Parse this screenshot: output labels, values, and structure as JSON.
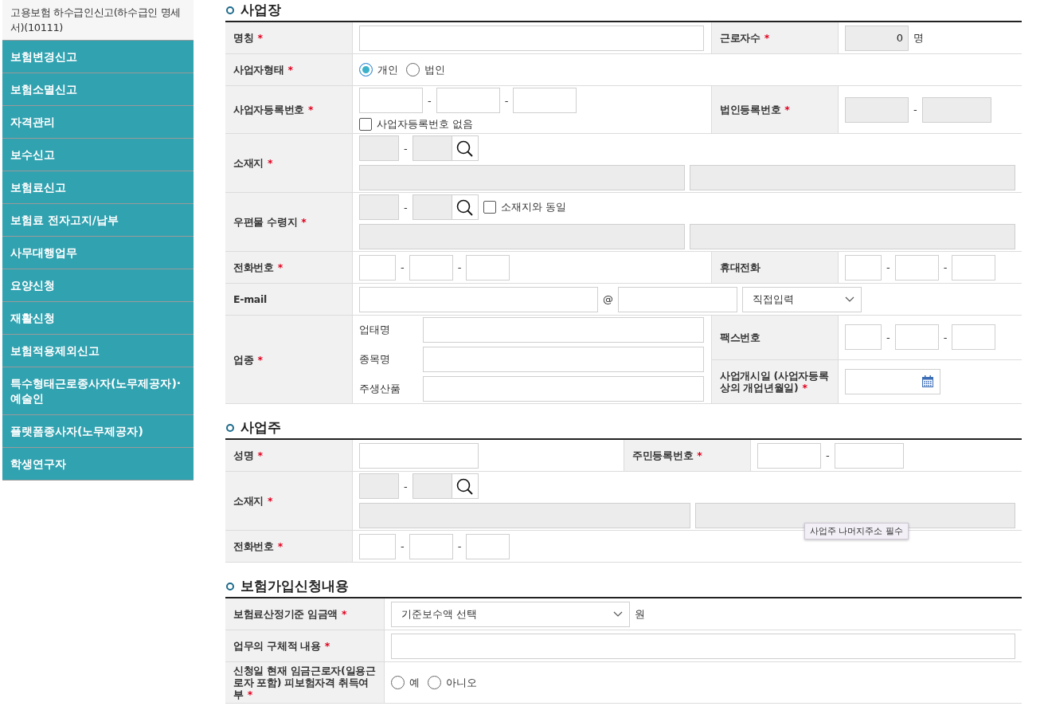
{
  "sidebar": {
    "current": "고용보험 하수급인신고(하수급인 명세서)(10111)",
    "items": [
      "보험변경신고",
      "보험소멸신고",
      "자격관리",
      "보수신고",
      "보험료신고",
      "보험료 전자고지/납부",
      "사무대행업무",
      "요양신청",
      "재활신청",
      "보험적용제외신고",
      "특수형태근로종사자(노무제공자)·예술인",
      "플랫폼종사자(노무제공자)",
      "학생연구자"
    ]
  },
  "sections": [
    {
      "title": "사업장",
      "rows": [
        {
          "fields": [
            {
              "label": "명칭",
              "required_mark": "*",
              "lines": [
                [
                  {
                    "kind": "input",
                    "disabled": false
                  }
                ]
              ]
            },
            {
              "label": "근로자수",
              "required_mark": "*",
              "lines": [
                [
                  {
                    "kind": "input",
                    "disabled": true,
                    "value": "0"
                  },
                  {
                    "kind": "unit",
                    "text": "명"
                  }
                ]
              ]
            }
          ]
        },
        {
          "fields": [
            {
              "label": "사업자형태",
              "required_mark": "*",
              "lines": [
                [
                  {
                    "kind": "radio",
                    "label": "개인",
                    "selected": true
                  },
                  {
                    "kind": "radio",
                    "label": "법인",
                    "selected": false
                  }
                ]
              ]
            }
          ]
        },
        {
          "fields": [
            {
              "label": "사업자등록번호",
              "required_mark": "*",
              "lines": [
                [
                  {
                    "kind": "input",
                    "disabled": false
                  },
                  {
                    "kind": "sep",
                    "text": "-"
                  },
                  {
                    "kind": "input",
                    "disabled": false
                  },
                  {
                    "kind": "sep",
                    "text": "-"
                  },
                  {
                    "kind": "input",
                    "disabled": false
                  }
                ],
                [
                  {
                    "kind": "checkbox",
                    "label": "사업자등록번호 없음",
                    "checked": false
                  }
                ]
              ]
            },
            {
              "label": "법인등록번호",
              "required_mark": "*",
              "lines": [
                [
                  {
                    "kind": "input",
                    "disabled": true
                  },
                  {
                    "kind": "sep",
                    "text": "-"
                  },
                  {
                    "kind": "input",
                    "disabled": true
                  }
                ]
              ]
            }
          ]
        },
        {
          "fields": [
            {
              "label": "소재지",
              "required_mark": "*",
              "lines": [
                [
                  {
                    "kind": "input",
                    "disabled": true
                  },
                  {
                    "kind": "sep",
                    "text": "-"
                  },
                  {
                    "kind": "input",
                    "disabled": true
                  },
                  {
                    "kind": "search"
                  }
                ],
                [
                  {
                    "kind": "input",
                    "disabled": true
                  },
                  {
                    "kind": "input",
                    "disabled": true
                  }
                ]
              ]
            }
          ]
        },
        {
          "fields": [
            {
              "label": "우편물 수령지",
              "required_mark": "*",
              "lines": [
                [
                  {
                    "kind": "input",
                    "disabled": true
                  },
                  {
                    "kind": "sep",
                    "text": "-"
                  },
                  {
                    "kind": "input",
                    "disabled": true
                  },
                  {
                    "kind": "search"
                  },
                  {
                    "kind": "checkbox",
                    "label": "소재지와 동일",
                    "checked": false
                  }
                ],
                [
                  {
                    "kind": "input",
                    "disabled": true
                  },
                  {
                    "kind": "input",
                    "disabled": true
                  }
                ]
              ]
            }
          ]
        },
        {
          "fields": [
            {
              "label": "전화번호",
              "required_mark": "*",
              "lines": [
                [
                  {
                    "kind": "input",
                    "disabled": false
                  },
                  {
                    "kind": "sep",
                    "text": "-"
                  },
                  {
                    "kind": "input",
                    "disabled": false
                  },
                  {
                    "kind": "sep",
                    "text": "-"
                  },
                  {
                    "kind": "input",
                    "disabled": false
                  }
                ]
              ]
            },
            {
              "label": "휴대전화",
              "lines": [
                [
                  {
                    "kind": "input",
                    "disabled": false
                  },
                  {
                    "kind": "sep",
                    "text": "-"
                  },
                  {
                    "kind": "input",
                    "disabled": false
                  },
                  {
                    "kind": "sep",
                    "text": "-"
                  },
                  {
                    "kind": "input",
                    "disabled": false
                  }
                ]
              ]
            }
          ]
        },
        {
          "fields": [
            {
              "label": "E-mail",
              "lines": [
                [
                  {
                    "kind": "input",
                    "disabled": false
                  },
                  {
                    "kind": "sep",
                    "text": "@"
                  },
                  {
                    "kind": "input",
                    "disabled": false
                  },
                  {
                    "kind": "select",
                    "value": "직접입력"
                  }
                ]
              ]
            }
          ]
        },
        {
          "fields": [
            {
              "label": "업종",
              "required_mark": "*",
              "lines": [
                [
                  {
                    "kind": "sublabel",
                    "text": "업태명"
                  },
                  {
                    "kind": "input",
                    "disabled": false
                  }
                ],
                [
                  {
                    "kind": "sublabel",
                    "text": "종목명"
                  },
                  {
                    "kind": "input",
                    "disabled": false
                  }
                ],
                [
                  {
                    "kind": "sublabel",
                    "text": "주생산품"
                  },
                  {
                    "kind": "input",
                    "disabled": false
                  }
                ]
              ]
            },
            {
              "stack": [
                {
                  "label": "팩스번호",
                  "lines": [
                    [
                      {
                        "kind": "input",
                        "disabled": false
                      },
                      {
                        "kind": "sep",
                        "text": "-"
                      },
                      {
                        "kind": "input",
                        "disabled": false
                      },
                      {
                        "kind": "sep",
                        "text": "-"
                      },
                      {
                        "kind": "input",
                        "disabled": false
                      }
                    ]
                  ]
                },
                {
                  "label": "사업개시일 (사업자등록상의 개업년월일)",
                  "required_mark": "*",
                  "lines": [
                    [
                      {
                        "kind": "date"
                      }
                    ]
                  ]
                }
              ]
            }
          ]
        }
      ]
    },
    {
      "title": "사업주",
      "rows": [
        {
          "fields": [
            {
              "label": "성명",
              "required_mark": "*",
              "lines": [
                [
                  {
                    "kind": "input",
                    "disabled": false
                  }
                ]
              ]
            },
            {
              "label": "주민등록번호",
              "required_mark": "*",
              "lines": [
                [
                  {
                    "kind": "input",
                    "disabled": false
                  },
                  {
                    "kind": "sep",
                    "text": "-"
                  },
                  {
                    "kind": "input",
                    "disabled": false
                  }
                ]
              ]
            }
          ]
        },
        {
          "fields": [
            {
              "label": "소재지",
              "required_mark": "*",
              "lines": [
                [
                  {
                    "kind": "input",
                    "disabled": true
                  },
                  {
                    "kind": "sep",
                    "text": "-"
                  },
                  {
                    "kind": "input",
                    "disabled": true
                  },
                  {
                    "kind": "search"
                  }
                ],
                [
                  {
                    "kind": "input",
                    "disabled": true
                  },
                  {
                    "kind": "input",
                    "disabled": true,
                    "tooltip": "사업주 나머지주소 필수"
                  }
                ]
              ]
            }
          ]
        },
        {
          "fields": [
            {
              "label": "전화번호",
              "required_mark": "*",
              "lines": [
                [
                  {
                    "kind": "input",
                    "disabled": false
                  },
                  {
                    "kind": "sep",
                    "text": "-"
                  },
                  {
                    "kind": "input",
                    "disabled": false
                  },
                  {
                    "kind": "sep",
                    "text": "-"
                  },
                  {
                    "kind": "input",
                    "disabled": false
                  }
                ]
              ]
            }
          ]
        }
      ]
    },
    {
      "title": "보험가입신청내용",
      "rows": [
        {
          "fields": [
            {
              "label": "보험료산정기준 임금액",
              "required_mark": "*",
              "lines": [
                [
                  {
                    "kind": "select",
                    "value": "기준보수액 선택"
                  },
                  {
                    "kind": "unit",
                    "text": "원"
                  }
                ]
              ]
            }
          ]
        },
        {
          "fields": [
            {
              "label": "업무의 구체적 내용",
              "required_mark": "*",
              "lines": [
                [
                  {
                    "kind": "input",
                    "disabled": false
                  }
                ]
              ]
            }
          ]
        },
        {
          "fields": [
            {
              "label": "신청일 현재 임금근로자(일용근로자 포함) 피보험자격 취득여부",
              "required_mark": "*",
              "lines": [
                [
                  {
                    "kind": "radio",
                    "label": "예",
                    "selected": false
                  },
                  {
                    "kind": "radio",
                    "label": "아니오",
                    "selected": false
                  }
                ]
              ]
            }
          ]
        }
      ]
    }
  ]
}
